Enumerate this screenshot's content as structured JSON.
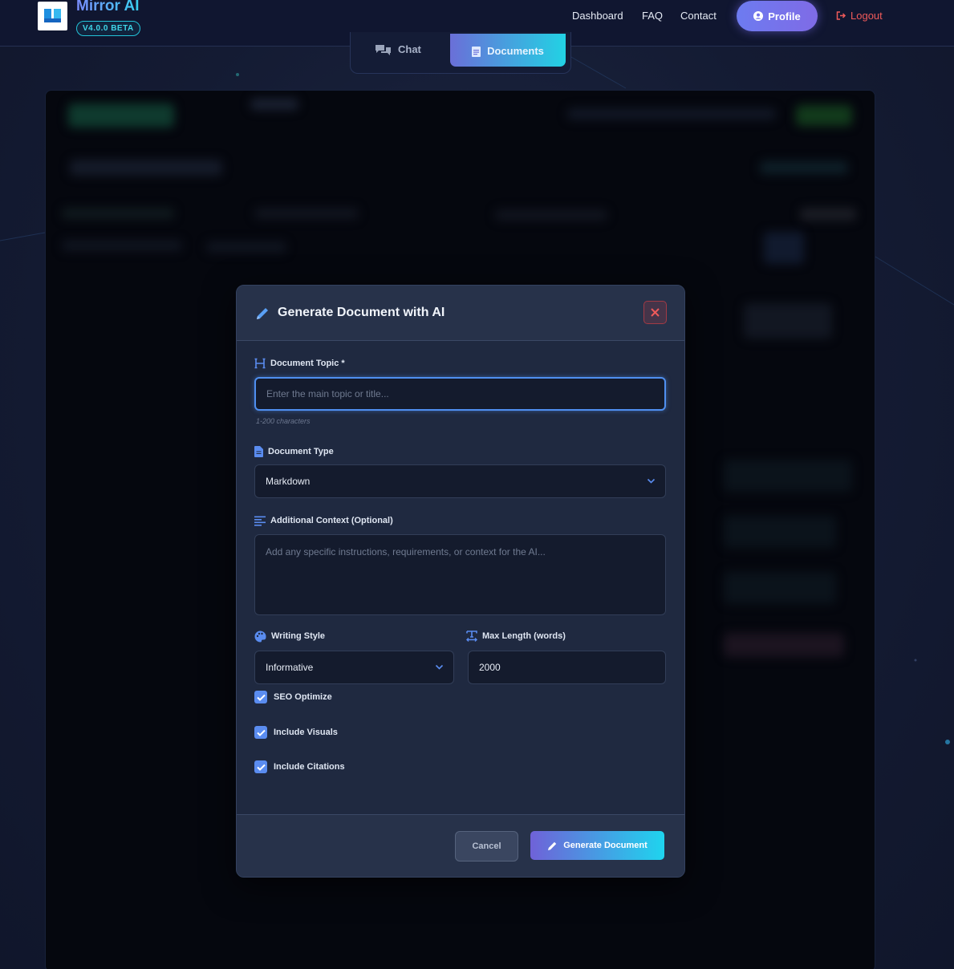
{
  "app": {
    "brand": "Mirror AI",
    "version": "V4.0.0 BETA"
  },
  "nav": {
    "dashboard": "Dashboard",
    "faq": "FAQ",
    "contact": "Contact",
    "profile": "Profile",
    "logout": "Logout"
  },
  "tabs": {
    "chat": "Chat",
    "documents": "Documents",
    "active": "Documents"
  },
  "modal": {
    "title": "Generate Document with AI",
    "topic": {
      "label": "Document Topic *",
      "placeholder": "Enter the main topic or title...",
      "hint": "1-200 characters",
      "value": ""
    },
    "type": {
      "label": "Document Type",
      "value": "Markdown"
    },
    "context": {
      "label": "Additional Context (Optional)",
      "placeholder": "Add any specific instructions, requirements, or context for the AI..."
    },
    "style": {
      "label": "Writing Style",
      "value": "Informative"
    },
    "max_length": {
      "label": "Max Length (words)",
      "value": "2000"
    },
    "options": [
      {
        "label": "SEO Optimize",
        "checked": true
      },
      {
        "label": "Include Visuals",
        "checked": true
      },
      {
        "label": "Include Citations",
        "checked": true
      }
    ],
    "cancel": "Cancel",
    "generate": "Generate Document"
  },
  "colors": {
    "accent": "#5a8cf0",
    "brand_gradient_start": "#6f62d8",
    "brand_gradient_end": "#1fd4ee",
    "danger": "#ef5a5a"
  }
}
